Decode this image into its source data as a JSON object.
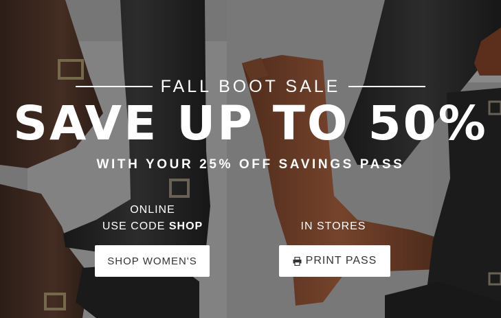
{
  "promo": {
    "eyebrow": "FALL BOOT SALE",
    "headline": "SAVE UP TO 50%",
    "subline": "WITH YOUR 25% OFF SAVINGS PASS"
  },
  "online": {
    "label": "ONLINE",
    "code_prefix": "USE CODE",
    "code": "SHOP",
    "button_label": "SHOP WOMEN'S"
  },
  "stores": {
    "label": "IN STORES",
    "button_icon": "printer-icon",
    "button_label": "PRINT PASS"
  },
  "colors": {
    "text": "#ffffff",
    "button_bg": "#ffffff",
    "button_text": "#333333",
    "overlay": "#5c5c5c",
    "boot_brown": "#6b3a23",
    "boot_black": "#1b1b1b"
  }
}
